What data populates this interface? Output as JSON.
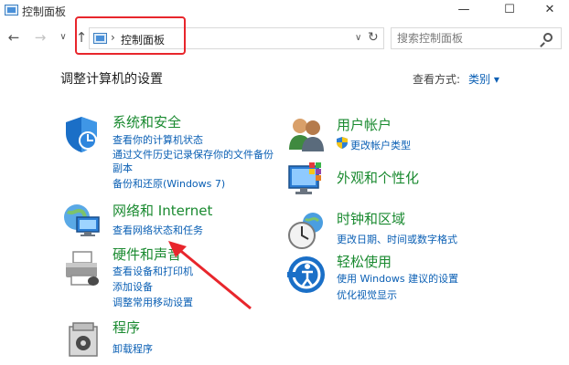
{
  "window": {
    "title": "控制面板",
    "minimize": "—",
    "maximize": "☐",
    "close": "✕"
  },
  "nav": {
    "back": "←",
    "forward": "→",
    "dropdown": "∨",
    "up": "↑",
    "breadcrumb_sep": "›",
    "breadcrumb": "控制面板",
    "address_dropdown": "∨",
    "refresh": "↻"
  },
  "search": {
    "placeholder": "搜索控制面板"
  },
  "header": {
    "title": "调整计算机的设置",
    "view_label": "查看方式:",
    "view_value": "类别 ▾"
  },
  "categories": {
    "system": {
      "title": "系统和安全",
      "links": [
        "查看你的计算机状态",
        "通过文件历史记录保存你的文件备份",
        "副本",
        "备份和还原(Windows 7)"
      ]
    },
    "network": {
      "title": "网络和 Internet",
      "links": [
        "查看网络状态和任务"
      ]
    },
    "hardware": {
      "title": "硬件和声音",
      "links": [
        "查看设备和打印机",
        "添加设备",
        "调整常用移动设置"
      ]
    },
    "programs": {
      "title": "程序",
      "links": [
        "卸载程序"
      ]
    },
    "users": {
      "title": "用户帐户",
      "links": [
        "更改帐户类型"
      ]
    },
    "appearance": {
      "title": "外观和个性化",
      "links": []
    },
    "clock": {
      "title": "时钟和区域",
      "links": [
        "更改日期、时间或数字格式"
      ]
    },
    "ease": {
      "title": "轻松使用",
      "links": [
        "使用 Windows 建议的设置",
        "优化视觉显示"
      ]
    }
  },
  "colors": {
    "category_title": "#1a8a30",
    "link": "#0a5fb4",
    "annotation_red": "#e8262c"
  }
}
